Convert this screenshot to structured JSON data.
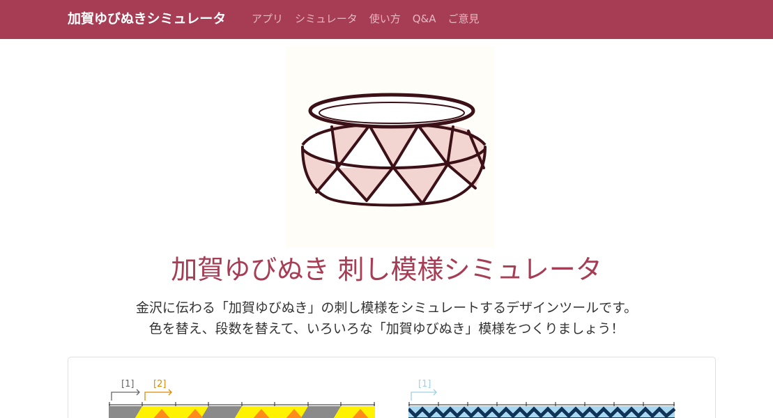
{
  "navbar": {
    "brand": "加賀ゆびぬきシミュレータ",
    "links": [
      {
        "label": "アプリ"
      },
      {
        "label": "シミュレータ"
      },
      {
        "label": "使い方"
      },
      {
        "label": "Q&A"
      },
      {
        "label": "ご意見"
      }
    ]
  },
  "hero": {
    "title": "加賀ゆびぬき 刺し模様シミュレータ",
    "lead_line1": "金沢に伝わる「加賀ゆびぬき」の刺し模様をシミュレートするデザインツールです。",
    "lead_line2": "色を替え、段数を替えて、いろいろな「加賀ゆびぬき」模様をつくりましょう！"
  },
  "preview": {
    "left_markers": [
      "[1]",
      "[2]"
    ],
    "right_markers": [
      "[1]"
    ]
  },
  "colors": {
    "brand": "#a63d54",
    "nav_link": "#e6b8c2",
    "thimble_outline": "#3b1016",
    "thimble_fill": "#f2d4d1",
    "marker_gray": "#666666",
    "marker_orange": "#e08a00",
    "marker_lightblue": "#9fd0e8",
    "pattern_gray": "#8a8a8a",
    "pattern_yellow": "#fff200",
    "pattern_orange": "#ff8c1a",
    "pattern_navy": "#0f3457",
    "pattern_lightblue": "#a8d8f0"
  }
}
